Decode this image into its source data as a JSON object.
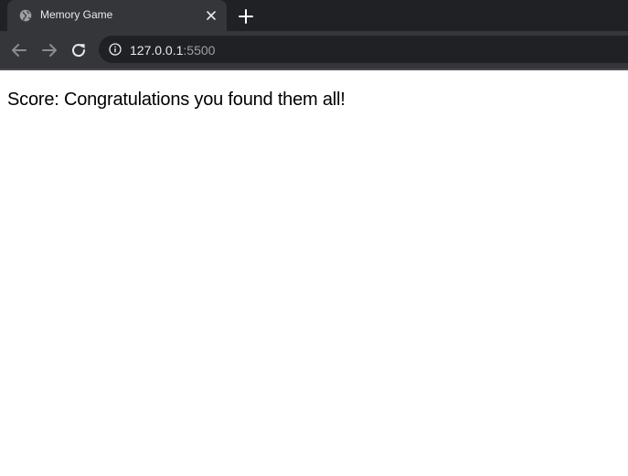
{
  "browser": {
    "tab": {
      "title": "Memory Game",
      "favicon": "globe-icon"
    },
    "address_bar": {
      "host": "127.0.0.1",
      "port": ":5500",
      "icon": "info-icon"
    },
    "colors": {
      "tabstrip": "#202124",
      "toolbar": "#35363a",
      "text": "#e8eaed"
    }
  },
  "page": {
    "score_label": "Score:",
    "score_message": "Congratulations you found them all!"
  }
}
